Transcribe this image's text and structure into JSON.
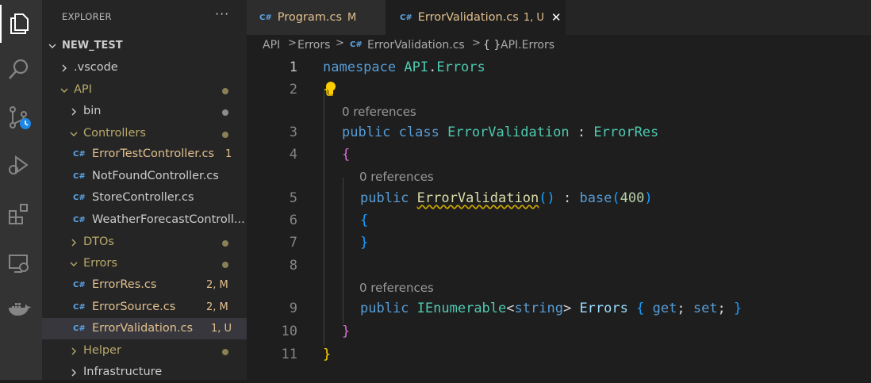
{
  "colors": {
    "activity_bg": "#333333",
    "sidebar_bg": "#252526",
    "editor_bg": "#1e1e1e",
    "modified": "#e2c08d",
    "folder_modified": "#b8a96a",
    "untracked": "#73c991",
    "error_badge": "#e2c08d",
    "cs_icon": "#5ca5e6"
  },
  "activity_bar": {
    "items": [
      "files-icon",
      "search-icon",
      "source-control-icon",
      "run-debug-icon",
      "extensions-icon",
      "remote-explorer-icon",
      "docker-icon"
    ]
  },
  "sidebar": {
    "title": "EXPLORER",
    "more": "···",
    "project": "NEW_TEST",
    "tree": [
      {
        "label": ".vscode",
        "type": "folder",
        "expanded": false,
        "depth": 1
      },
      {
        "label": "API",
        "type": "folder",
        "expanded": true,
        "depth": 1,
        "dot": true
      },
      {
        "label": "bin",
        "type": "folder",
        "expanded": false,
        "depth": 2,
        "dot": true
      },
      {
        "label": "Controllers",
        "type": "folder",
        "expanded": true,
        "depth": 2,
        "dot": true
      },
      {
        "label": "ErrorTestController.cs",
        "type": "file",
        "depth": 3,
        "badge": "1"
      },
      {
        "label": "NotFoundController.cs",
        "type": "file",
        "depth": 3
      },
      {
        "label": "StoreController.cs",
        "type": "file",
        "depth": 3
      },
      {
        "label": "WeatherForecastControll...",
        "type": "file",
        "depth": 3
      },
      {
        "label": "DTOs",
        "type": "folder",
        "expanded": false,
        "depth": 2,
        "dot": true
      },
      {
        "label": "Errors",
        "type": "folder",
        "expanded": true,
        "depth": 2,
        "dot": true
      },
      {
        "label": "ErrorRes.cs",
        "type": "file",
        "depth": 3,
        "badge": "2, M"
      },
      {
        "label": "ErrorSource.cs",
        "type": "file",
        "depth": 3,
        "badge": "2, M"
      },
      {
        "label": "ErrorValidation.cs",
        "type": "file",
        "depth": 3,
        "badge": "1, U",
        "selected": true
      },
      {
        "label": "Helper",
        "type": "folder",
        "expanded": false,
        "depth": 2,
        "dot": true
      },
      {
        "label": "Infrastructure",
        "type": "folder",
        "expanded": false,
        "depth": 2
      }
    ]
  },
  "tabs": [
    {
      "icon": "C#",
      "label": "Program.cs",
      "status": "M",
      "active": false
    },
    {
      "icon": "C#",
      "label": "ErrorValidation.cs",
      "status": "1, U",
      "active": true,
      "close": "✕"
    }
  ],
  "breadcrumbs": {
    "items": [
      "API",
      "Errors",
      "C#",
      "ErrorValidation.cs",
      "{ }",
      "API.Errors"
    ]
  },
  "editor": {
    "line_numbers": [
      "1",
      "2",
      "3",
      "4",
      "5",
      "6",
      "7",
      "8",
      "9",
      "10",
      "11"
    ],
    "active_line": "1",
    "codelens": "0 references",
    "tokens": {
      "l1": [
        "namespace",
        "API",
        ".",
        "Errors"
      ],
      "l2": [
        "{"
      ],
      "l3": [
        "public",
        "class",
        "ErrorValidation",
        ":",
        "ErrorRes"
      ],
      "l4": [
        "{"
      ],
      "l5": [
        "public",
        "ErrorValidation",
        "(",
        ")",
        ":",
        "base",
        "(",
        "400",
        ")"
      ],
      "l6": [
        "{"
      ],
      "l7": [
        "}"
      ],
      "l9": [
        "public",
        "IEnumerable",
        "<",
        "string",
        ">",
        "Errors",
        "{",
        "get",
        ";",
        "set",
        ";",
        "}"
      ],
      "l10": [
        "}"
      ],
      "l11": [
        "}"
      ]
    }
  }
}
